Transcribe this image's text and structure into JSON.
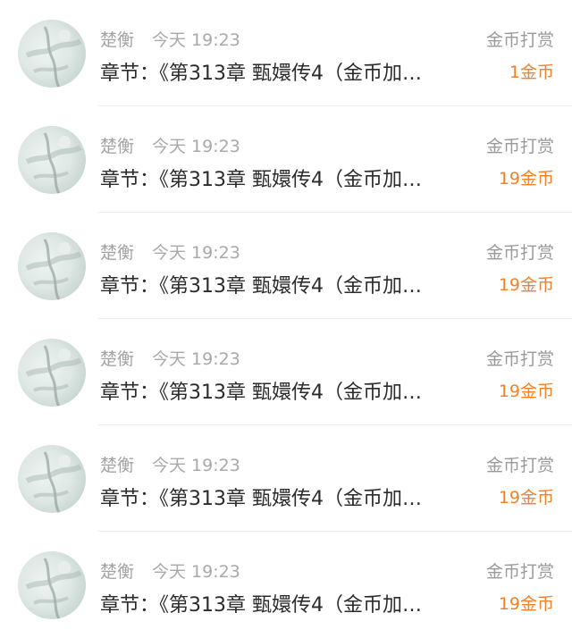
{
  "rows": [
    {
      "name": "楚衡",
      "time": "今天 19:23",
      "type": "金币打赏",
      "chapter": "章节：《第313章 甄嬛传4（金币加…",
      "amount": "1金币"
    },
    {
      "name": "楚衡",
      "time": "今天 19:23",
      "type": "金币打赏",
      "chapter": "章节：《第313章 甄嬛传4（金币加…",
      "amount": "19金币"
    },
    {
      "name": "楚衡",
      "time": "今天 19:23",
      "type": "金币打赏",
      "chapter": "章节：《第313章 甄嬛传4（金币加…",
      "amount": "19金币"
    },
    {
      "name": "楚衡",
      "time": "今天 19:23",
      "type": "金币打赏",
      "chapter": "章节：《第313章 甄嬛传4（金币加…",
      "amount": "19金币"
    },
    {
      "name": "楚衡",
      "time": "今天 19:23",
      "type": "金币打赏",
      "chapter": "章节：《第313章 甄嬛传4（金币加…",
      "amount": "19金币"
    },
    {
      "name": "楚衡",
      "time": "今天 19:23",
      "type": "金币打赏",
      "chapter": "章节：《第313章 甄嬛传4（金币加…",
      "amount": "19金币"
    }
  ],
  "colors": {
    "amount": "#f2822a",
    "meta": "#a3a3a3",
    "title": "#2b2b2b"
  }
}
